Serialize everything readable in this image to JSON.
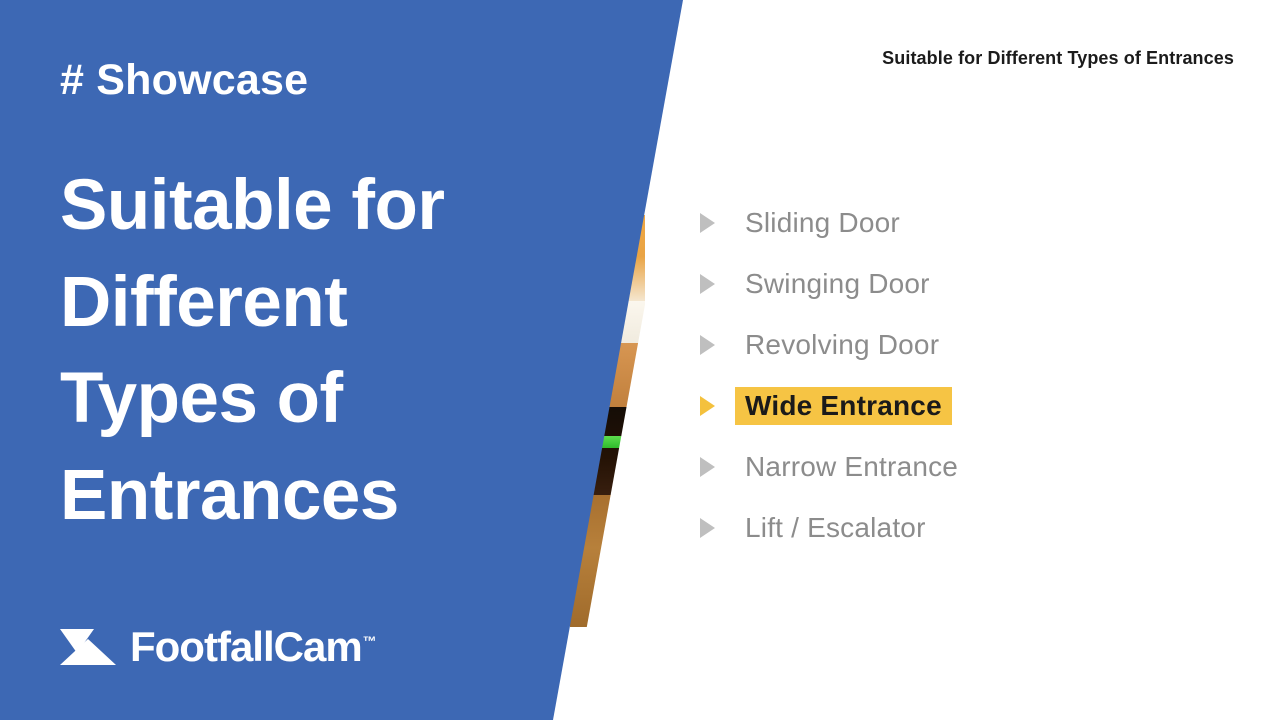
{
  "slide": {
    "kicker": "# Showcase",
    "headline": "Suitable for Different Types of Entrances",
    "right_header": "Suitable for Different Types of Entrances",
    "brand": {
      "name": "FootfallCam",
      "trademark": "™",
      "mark_icon": "footfallcam-hourglass-icon"
    },
    "colors": {
      "panel_blue": "#3D68B4",
      "highlight_yellow": "#F6C444",
      "bullet_gray": "#BFBFBF",
      "label_gray": "#8C8C8C",
      "active_label_text": "#1A1A1A",
      "background_white": "#FFFFFF"
    }
  },
  "toc": {
    "items": [
      {
        "label": "Sliding Door",
        "active": false
      },
      {
        "label": "Swinging Door",
        "active": false
      },
      {
        "label": "Revolving Door",
        "active": false
      },
      {
        "label": "Wide Entrance",
        "active": true
      },
      {
        "label": "Narrow Entrance",
        "active": false
      },
      {
        "label": "Lift / Escalator",
        "active": false
      }
    ]
  },
  "media": {
    "description": "store-entrance-video-strip"
  }
}
